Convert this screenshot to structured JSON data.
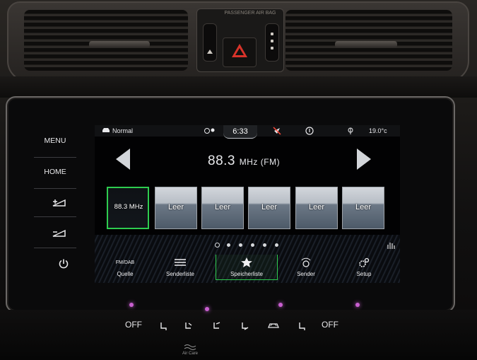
{
  "vent_panel": {
    "airbag_label": "PASSENGER AIR BAG"
  },
  "side_buttons": {
    "menu": "MENU",
    "home": "HOME"
  },
  "status_bar": {
    "profile": "Normal",
    "time": "6:33",
    "temperature": "19.0°c"
  },
  "radio": {
    "frequency": "88.3",
    "frequency_unit": "MHz (FM)"
  },
  "presets": [
    {
      "label": "88.3 MHz",
      "active": true
    },
    {
      "label": "Leer",
      "active": false
    },
    {
      "label": "Leer",
      "active": false
    },
    {
      "label": "Leer",
      "active": false
    },
    {
      "label": "Leer",
      "active": false
    },
    {
      "label": "Leer",
      "active": false
    }
  ],
  "pager": {
    "pages": 6,
    "current": 1
  },
  "bottom_menu": {
    "source_top": "FM/DAB",
    "source": "Quelle",
    "station_list": "Senderliste",
    "memory_list": "Speicherliste",
    "station": "Sender",
    "setup": "Setup"
  },
  "climate": {
    "left": "OFF",
    "right": "OFF",
    "aircare": "Air Care"
  },
  "colors": {
    "accent_green": "#2ecc4f",
    "hazard_red": "#d8332a",
    "ambient_glow": "#c85fd0"
  }
}
